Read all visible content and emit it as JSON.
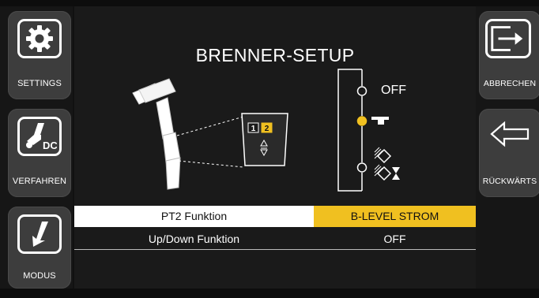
{
  "title": "BRENNER-SETUP",
  "left_buttons": [
    {
      "label": "SETTINGS",
      "icon": "gear-icon"
    },
    {
      "label": "VERFAHREN",
      "icon": "torch-dc-icon",
      "badge": "DC"
    },
    {
      "label": "MODUS",
      "icon": "arrow-down-left-icon"
    }
  ],
  "right_buttons": [
    {
      "label": "ABBRECHEN",
      "icon": "exit-arrow-icon"
    },
    {
      "label": "RÜCKWÄRTS",
      "icon": "back-arrow-icon"
    }
  ],
  "diagram": {
    "pt_keys": [
      "1",
      "2"
    ],
    "active_key": "2",
    "options": [
      "OFF",
      "current-level-icon",
      "diamond-level-icon",
      "diamond-hourglass-icon"
    ],
    "selected_option_index": 1
  },
  "settings_rows": [
    {
      "name": "PT2 Funktion",
      "value": "B-LEVEL STROM",
      "selected": true
    },
    {
      "name": "Up/Down Funktion",
      "value": "OFF",
      "selected": false
    }
  ],
  "colors": {
    "accent": "#f0c020",
    "button_bg": "#3d3d3d",
    "screen_bg": "#1a1a1a"
  }
}
